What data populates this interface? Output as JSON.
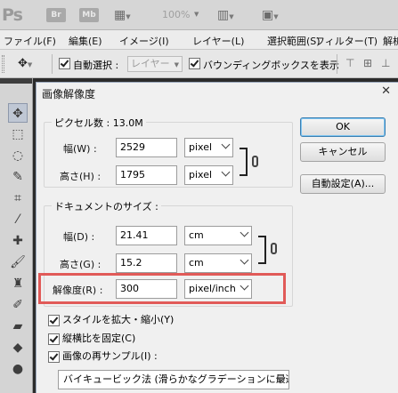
{
  "appbar": {
    "logo": "Ps",
    "bridge_label": "Br",
    "minibridge_label": "Mb",
    "zoom": "100%"
  },
  "menubar": {
    "items": [
      "ファイル(F)",
      "編集(E)",
      "イメージ(I)",
      "レイヤー(L)",
      "選択範囲(S)",
      "フィルター(T)",
      "解析"
    ]
  },
  "options": {
    "auto_select_label": "自動選択 :",
    "auto_select_target": "レイヤー",
    "bounding_box_label": "バウンディングボックスを表示"
  },
  "dialog": {
    "title": "画像解像度",
    "close_glyph": "✕",
    "pixel_dims": {
      "legend": "ピクセル数 : 13.0M",
      "width_label": "幅(W) :",
      "width_value": "2529",
      "width_unit": "pixel",
      "height_label": "高さ(H) :",
      "height_value": "1795",
      "height_unit": "pixel"
    },
    "doc_size": {
      "legend": "ドキュメントのサイズ :",
      "width_label": "幅(D) :",
      "width_value": "21.41",
      "width_unit": "cm",
      "height_label": "高さ(G) :",
      "height_value": "15.2",
      "height_unit": "cm",
      "res_label": "解像度(R) :",
      "res_value": "300",
      "res_unit": "pixel/inch"
    },
    "buttons": {
      "ok": "OK",
      "cancel": "キャンセル",
      "auto": "自動設定(A)..."
    },
    "checkboxes": {
      "scale_styles": "スタイルを拡大・縮小(Y)",
      "constrain": "縦横比を固定(C)",
      "resample": "画像の再サンプル(I) :"
    },
    "resample_method": "バイキュービック法 (滑らかなグラデーションに最適)"
  }
}
